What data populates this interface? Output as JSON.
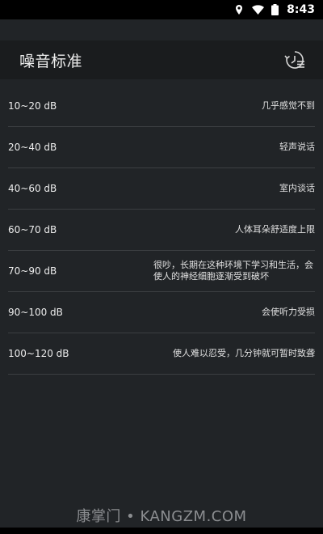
{
  "status_bar": {
    "time": "8:43",
    "icons": [
      "location-icon",
      "wifi-icon",
      "battery-icon"
    ]
  },
  "app_bar": {
    "title": "噪音标准",
    "action_icon": "history-icon"
  },
  "levels": [
    {
      "range": "10~20 dB",
      "desc": "几乎感觉不到"
    },
    {
      "range": "20~40 dB",
      "desc": "轻声说话"
    },
    {
      "range": "40~60 dB",
      "desc": "室内谈话"
    },
    {
      "range": "60~70 dB",
      "desc": "人体耳朵舒适度上限"
    },
    {
      "range": "70~90 dB",
      "desc": "很吵，长期在这种环境下学习和生活，会使人的神经细胞逐渐受到破坏"
    },
    {
      "range": "90~100 dB",
      "desc": "会使听力受损"
    },
    {
      "range": "100~120 dB",
      "desc": "使人难以忍受，几分钟就可暂时致聋"
    }
  ],
  "watermark": "康掌门 • KANGZM.COM",
  "colors": {
    "background": "#212427",
    "app_bar": "#1a1c1e",
    "divider": "#3c3f42",
    "status_bar": "#000000"
  }
}
